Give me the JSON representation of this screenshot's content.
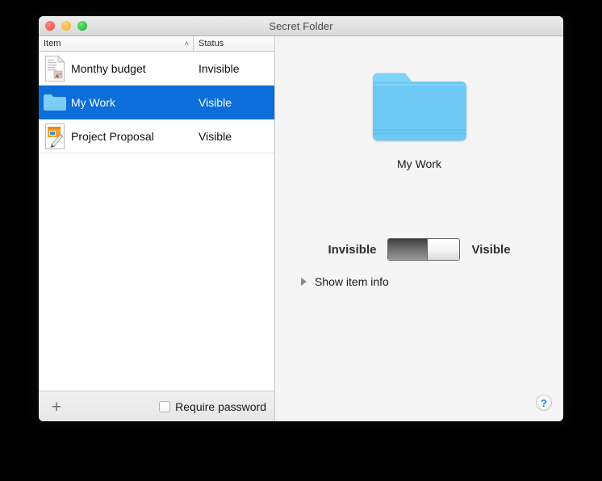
{
  "window": {
    "title": "Secret Folder",
    "traffic_lights": [
      "close",
      "minimize",
      "zoom"
    ]
  },
  "list": {
    "headers": {
      "item": "Item",
      "status": "Status",
      "sort_indicator": "˄"
    },
    "rows": [
      {
        "icon": "document-icon",
        "name": "Monthy budget",
        "status": "Invisible",
        "selected": false
      },
      {
        "icon": "folder-icon",
        "name": "My Work",
        "status": "Visible",
        "selected": true
      },
      {
        "icon": "document-pencil-icon",
        "name": "Project Proposal",
        "status": "Visible",
        "selected": false
      }
    ]
  },
  "bottom_bar": {
    "add_label": "+",
    "require_password_label": "Require password",
    "require_password_checked": false
  },
  "detail": {
    "item_name": "My Work",
    "item_icon": "folder-icon",
    "toggle": {
      "left_label": "Invisible",
      "right_label": "Visible",
      "state": "Visible"
    },
    "disclosure_label": "Show item info",
    "help_label": "?"
  },
  "colors": {
    "selection_blue": "#0b6edb",
    "folder_blue": "#6ec9f5",
    "help_blue": "#1a7ef0",
    "pane_gray": "#f5f5f5"
  }
}
